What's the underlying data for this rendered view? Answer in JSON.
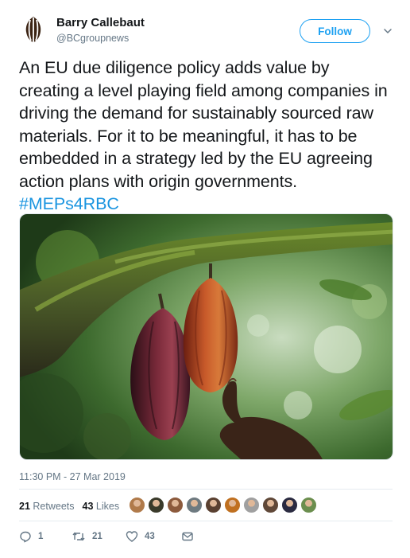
{
  "author": {
    "name": "Barry Callebaut",
    "handle": "@BCgroupnews",
    "avatar_icon": "cocoa-pod-logo"
  },
  "follow_button_label": "Follow",
  "tweet": {
    "text": "An EU due diligence policy adds value by creating a level playing field among companies in driving the demand for sustainably sourced raw materials. For it to be meaningful, it has to be embedded in a strategy led by the EU agreeing action plans with origin governments. ",
    "hashtag": "#MEPs4RBC",
    "timestamp": "11:30 PM - 27 Mar 2019"
  },
  "stats": {
    "retweets_count": "21",
    "retweets_label": "Retweets",
    "likes_count": "43",
    "likes_label": "Likes"
  },
  "liker_faces": [
    {
      "color": "#b07a4a"
    },
    {
      "color": "#3a3a2a"
    },
    {
      "color": "#8c5a3c"
    },
    {
      "color": "#6e7a80"
    },
    {
      "color": "#5a4030"
    },
    {
      "color": "#c07020"
    },
    {
      "color": "#a0a0a0"
    },
    {
      "color": "#604838"
    },
    {
      "color": "#2a2a40"
    },
    {
      "color": "#6b8e4e"
    }
  ],
  "actions": {
    "reply_count": "1",
    "retweet_count": "21",
    "like_count": "43"
  },
  "colors": {
    "accent": "#1da1f2",
    "hashtag": "#1b95e0",
    "muted": "#657786"
  }
}
